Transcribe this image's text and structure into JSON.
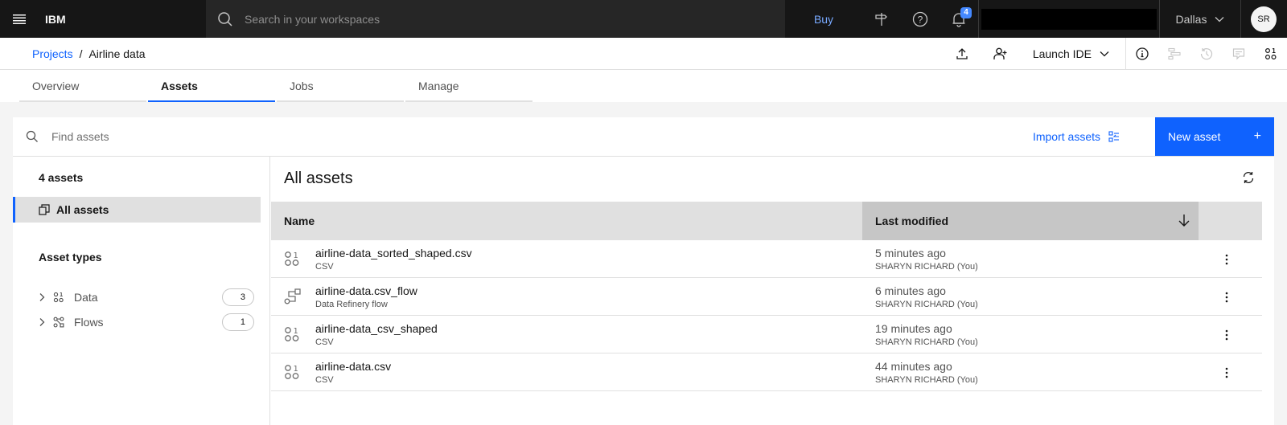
{
  "header": {
    "brand": "IBM",
    "search_placeholder": "Search in your workspaces",
    "buy_label": "Buy",
    "notification_count": "4",
    "region": "Dallas",
    "avatar_initials": "SR"
  },
  "breadcrumb": {
    "parent": "Projects",
    "separator": "/",
    "current": "Airline data"
  },
  "toolbar": {
    "launch_ide_label": "Launch IDE"
  },
  "tabs": [
    {
      "label": "Overview",
      "active": false
    },
    {
      "label": "Assets",
      "active": true
    },
    {
      "label": "Jobs",
      "active": false
    },
    {
      "label": "Manage",
      "active": false
    }
  ],
  "find": {
    "placeholder": "Find assets",
    "import_label": "Import assets",
    "new_asset_label": "New asset",
    "new_asset_icon": "+"
  },
  "left_nav": {
    "count_title": "4 assets",
    "all_assets_label": "All assets",
    "asset_types_title": "Asset types",
    "types": [
      {
        "label": "Data",
        "count": "3",
        "icon": "data-icon"
      },
      {
        "label": "Flows",
        "count": "1",
        "icon": "flows-icon"
      }
    ]
  },
  "content": {
    "title": "All assets",
    "columns": {
      "name": "Name",
      "last_modified": "Last modified"
    },
    "rows": [
      {
        "name": "airline-data_sorted_shaped.csv",
        "type": "CSV",
        "modified": "5 minutes ago",
        "owner": "SHARYN RICHARD (You)",
        "icon": "data-icon"
      },
      {
        "name": "airline-data.csv_flow",
        "type": "Data Refinery flow",
        "modified": "6 minutes ago",
        "owner": "SHARYN RICHARD (You)",
        "icon": "flow-icon"
      },
      {
        "name": "airline-data_csv_shaped",
        "type": "CSV",
        "modified": "19 minutes ago",
        "owner": "SHARYN RICHARD (You)",
        "icon": "data-icon"
      },
      {
        "name": "airline-data.csv",
        "type": "CSV",
        "modified": "44 minutes ago",
        "owner": "SHARYN RICHARD (You)",
        "icon": "data-icon"
      }
    ]
  },
  "colors": {
    "accent": "#0f62fe",
    "header_bg": "#161616",
    "link_on_dark": "#78a9ff"
  }
}
